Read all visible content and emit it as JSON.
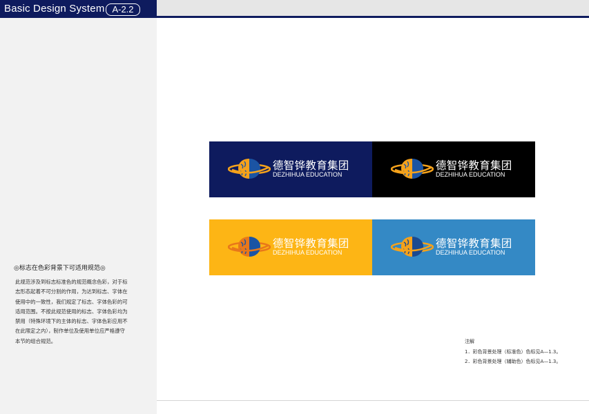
{
  "header": {
    "title": "Basic Design System",
    "code": "A-2.2"
  },
  "section": {
    "heading": "◎标志在色彩背景下可适用规范◎",
    "body": "此规范涉及到标志标准色的规范概念色彩，对于标志形态起着不可分割的作用，为达到标志、字体在使用中的一致性，我们规定了标志、字体色彩的可适用范围。不按此规范使用的标志、字体色彩均为禁用（特殊环境下的主体的标志、字体色彩应用不在此限定之内），制作单位及使用单位应严格遵守本节的组合规范。"
  },
  "logo": {
    "name_cn": "德智铧教育集团",
    "name_en": "DEZHIHUA EDUCATION",
    "icon": "globe-brain-ring-icon"
  },
  "swatches": [
    {
      "background": "#0e1b5e",
      "ring_color": "#f5a21b",
      "globe_color": "#1b54a3"
    },
    {
      "background": "#000000",
      "ring_color": "#f5a21b",
      "globe_color": "#1b54a3"
    },
    {
      "background": "#fdb515",
      "ring_color": "#e8771a",
      "globe_color": "#1b54a3"
    },
    {
      "background": "#3489c5",
      "ring_color": "#f5a21b",
      "globe_color": "#1b4a90"
    }
  ],
  "notes": {
    "title": "注解",
    "items": [
      "1．彩色背景处理（标准色）色标见A—1.3。",
      "2．彩色背景处理（辅助色）色标见A—1.3。"
    ]
  },
  "colors": {
    "brand_navy": "#0e1b5e",
    "brand_orange": "#f5a21b",
    "brand_blue": "#1b54a3"
  }
}
